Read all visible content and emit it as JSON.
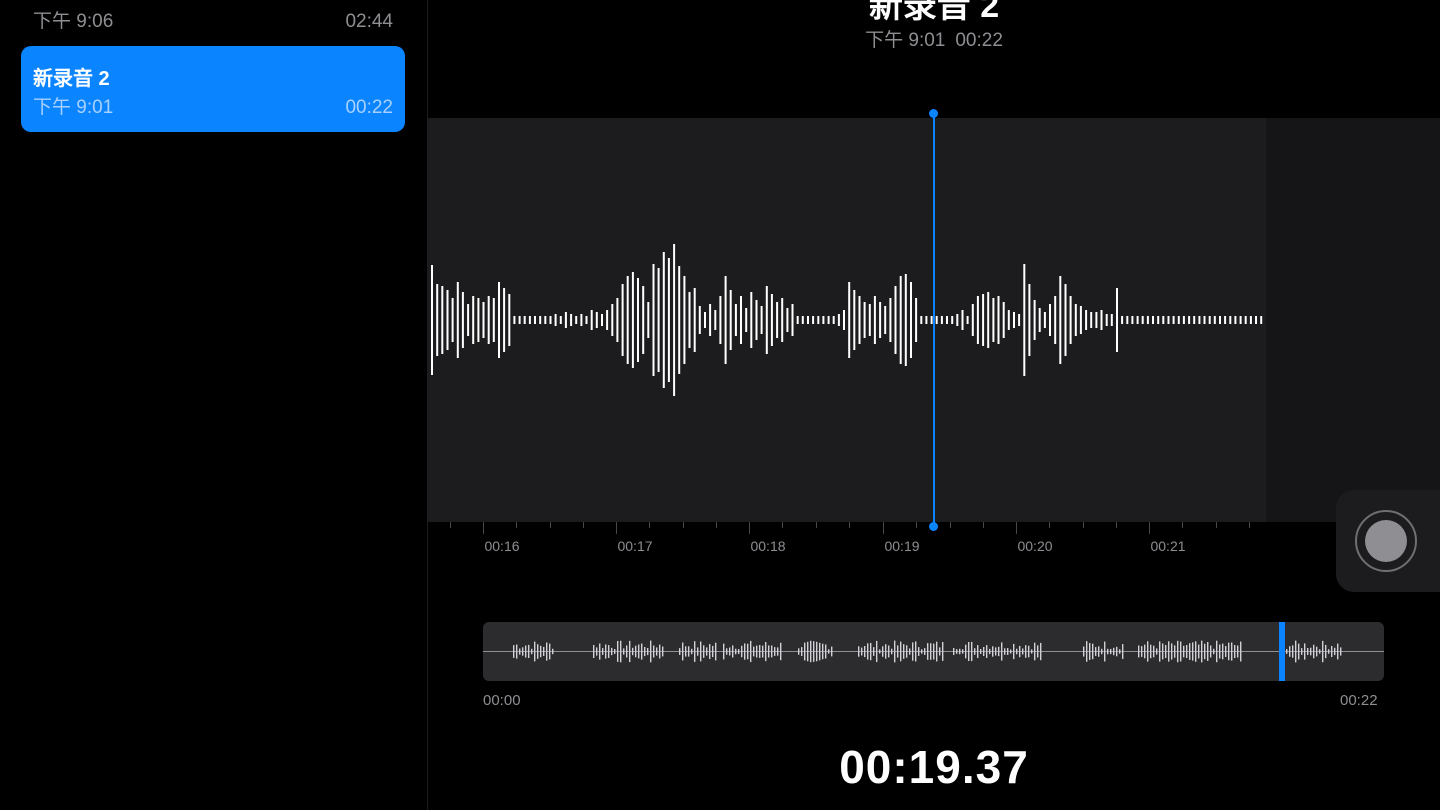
{
  "recordings": [
    {
      "name": "",
      "date": "下午 9:06",
      "duration": "02:44"
    },
    {
      "name": "新录音 2",
      "date": "下午 9:01",
      "duration": "00:22"
    }
  ],
  "detail": {
    "title": "新录音 2",
    "date": "下午 9:01",
    "duration": "00:22",
    "current_time": "00:19.37",
    "timeline_labels": [
      "00:16",
      "00:17",
      "00:18",
      "00:19",
      "00:20",
      "00:21"
    ],
    "overview_start": "00:00",
    "overview_end": "00:22"
  },
  "colors": {
    "accent": "#0a84ff",
    "background": "#000000",
    "waveform": "#ffffff"
  },
  "icons": {
    "record": "record-button-icon"
  }
}
